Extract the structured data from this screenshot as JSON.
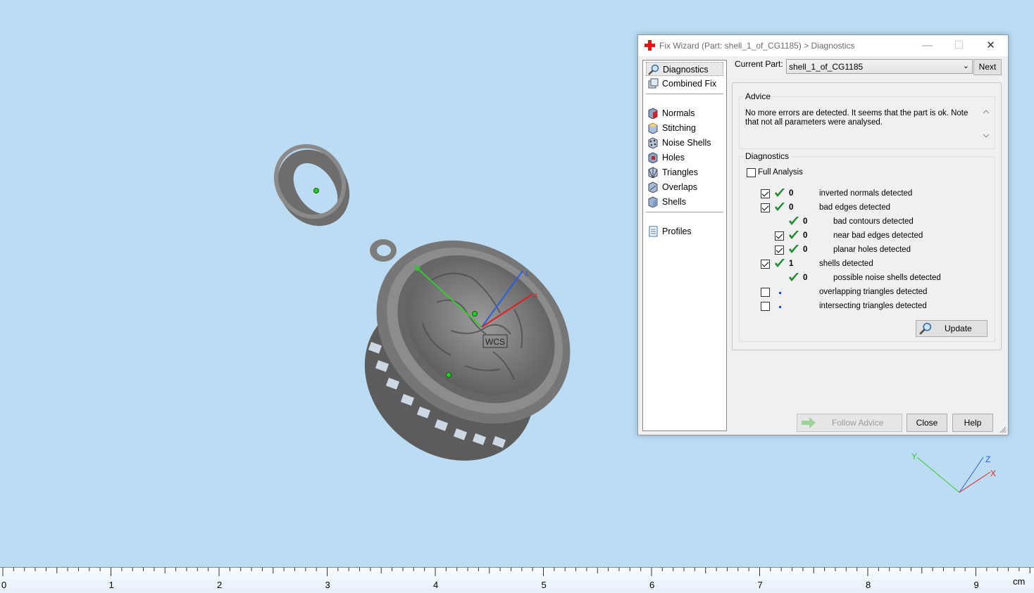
{
  "dialog": {
    "title": "Fix Wizard (Part: shell_1_of_CG1185) > Diagnostics",
    "window_buttons": {
      "minimize": "—",
      "maximize": "☐",
      "close": "✕"
    },
    "nav": [
      {
        "label": "Diagnostics",
        "icon": "magnifier-icon",
        "selected": true
      },
      {
        "label": "Combined Fix",
        "icon": "combined-fix-icon"
      },
      {
        "label": "Normals",
        "icon": "normals-icon"
      },
      {
        "label": "Stitching",
        "icon": "stitching-icon"
      },
      {
        "label": "Noise Shells",
        "icon": "noise-shells-icon"
      },
      {
        "label": "Holes",
        "icon": "holes-icon"
      },
      {
        "label": "Triangles",
        "icon": "triangles-icon"
      },
      {
        "label": "Overlaps",
        "icon": "overlaps-icon"
      },
      {
        "label": "Shells",
        "icon": "shells-icon"
      },
      {
        "label": "Profiles",
        "icon": "profiles-icon"
      }
    ],
    "current_part_label": "Current Part:",
    "current_part_value": "shell_1_of_CG1185",
    "next_label": "Next",
    "advice": {
      "title": "Advice",
      "text": "No more errors are detected. It seems that the part is ok. Note that not all parameters were analysed."
    },
    "diagnostics": {
      "title": "Diagnostics",
      "full_analysis_label": "Full Analysis",
      "full_analysis_checked": false,
      "rows": [
        {
          "checkbox": true,
          "checked": true,
          "status": "ok",
          "count": "0",
          "label": "inverted normals detected",
          "indent": 0
        },
        {
          "checkbox": true,
          "checked": true,
          "status": "ok",
          "count": "0",
          "label": "bad edges detected",
          "indent": 0
        },
        {
          "checkbox": false,
          "checked": false,
          "status": "ok",
          "count": "0",
          "label": "bad contours detected",
          "indent": 1
        },
        {
          "checkbox": true,
          "checked": true,
          "status": "ok",
          "count": "0",
          "label": "near bad edges detected",
          "indent": 1
        },
        {
          "checkbox": true,
          "checked": true,
          "status": "ok",
          "count": "0",
          "label": "planar holes detected",
          "indent": 1
        },
        {
          "checkbox": true,
          "checked": true,
          "status": "ok",
          "count": "1",
          "label": "shells detected",
          "indent": 0
        },
        {
          "checkbox": false,
          "checked": false,
          "status": "ok",
          "count": "0",
          "label": "possible noise shells detected",
          "indent": 1
        },
        {
          "checkbox": true,
          "checked": false,
          "status": "unknown",
          "count": "",
          "label": "overlapping triangles detected",
          "indent": 0
        },
        {
          "checkbox": true,
          "checked": false,
          "status": "unknown",
          "count": "",
          "label": "intersecting triangles detected",
          "indent": 0
        }
      ],
      "update_label": "Update"
    },
    "buttons": {
      "follow_advice": "Follow Advice",
      "close": "Close",
      "help": "Help"
    }
  },
  "viewport": {
    "wcs_label": "WCS",
    "axes": {
      "x": "x",
      "y": "y",
      "z": "z"
    },
    "triad": {
      "x": "X",
      "y": "Y",
      "z": "Z"
    }
  },
  "ruler": {
    "labels": [
      "0",
      "1",
      "2",
      "3",
      "4",
      "5",
      "6",
      "7",
      "8",
      "9"
    ],
    "unit": "cm"
  },
  "colors": {
    "background": "#bcdcf4",
    "check_green": "#1e8a2e",
    "x_axis": "#e02020",
    "y_axis": "#36c832",
    "z_axis": "#2c5fe0"
  }
}
